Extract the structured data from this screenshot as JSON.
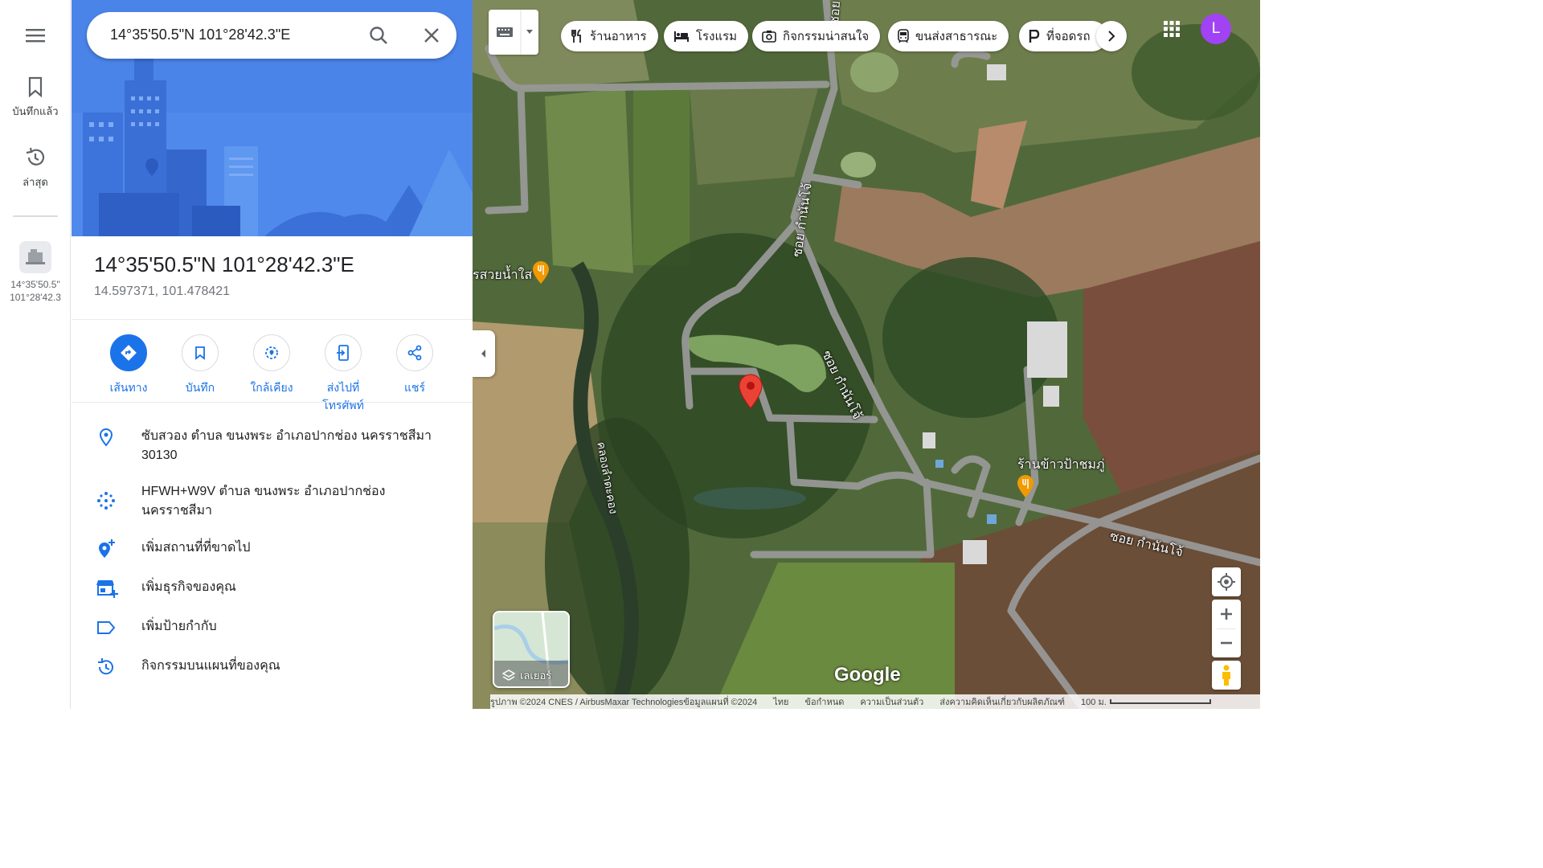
{
  "rail": {
    "saved_label": "บันทึกแล้ว",
    "recent_label": "ล่าสุด",
    "recent_item_line1": "14°35'50.5\"",
    "recent_item_line2": "101°28'42.3"
  },
  "search": {
    "query": "14°35'50.5\"N 101°28'42.3\"E"
  },
  "place": {
    "title": "14°35'50.5\"N 101°28'42.3\"E",
    "decimal": "14.597371, 101.478421"
  },
  "actions": [
    {
      "label": "เส้นทาง",
      "icon": "directions-icon"
    },
    {
      "label": "บันทึก",
      "icon": "bookmark-icon"
    },
    {
      "label": "ใกล้เคียง",
      "icon": "nearby-icon"
    },
    {
      "label": "ส่งไปที่โทรศัพท์",
      "icon": "send-to-phone-icon"
    },
    {
      "label": "แชร์",
      "icon": "share-icon"
    }
  ],
  "info": {
    "address": "ซับสวอง ตำบล ขนงพระ อำเภอปากช่อง นครราชสีมา 30130",
    "plus_code": "HFWH+W9V ตำบล ขนงพระ อำเภอปากช่อง นครราชสีมา",
    "add_missing_place": "เพิ่มสถานที่ที่ขาดไป",
    "add_business": "เพิ่มธุรกิจของคุณ",
    "add_label": "เพิ่มป้ายกำกับ",
    "map_activity": "กิจกรรมบนแผนที่ของคุณ"
  },
  "chips": [
    {
      "label": "ร้านอาหาร",
      "icon": "restaurant-icon"
    },
    {
      "label": "โรงแรม",
      "icon": "hotel-icon"
    },
    {
      "label": "กิจกรรมน่าสนใจ",
      "icon": "camera-icon"
    },
    {
      "label": "ขนส่งสาธารณะ",
      "icon": "transit-icon"
    },
    {
      "label": "ที่จอดรถ",
      "icon": "parking-icon"
    }
  ],
  "user": {
    "initial": "L"
  },
  "map_labels": {
    "road_1": "ซอย กำนันโจ้",
    "road_2": "ซอย กำนันโจ้",
    "road_3": "ซอย กำนันโจ้",
    "road_4": "ซอย กำนันโจ้",
    "canal": "คลองลำตะคอง",
    "poi_1": "รสวยน้ำใส",
    "poi_2": "ร้านข้าวป้าชมภู่"
  },
  "layers_label": "เลเยอร์",
  "brand": "Google",
  "footer": {
    "imagery": "รูปภาพ ©2024 CNES / AirbusMaxar Technologiesข้อมูลแผนที่ ©2024",
    "lang": "ไทย",
    "terms": "ข้อกำหนด",
    "privacy": "ความเป็นส่วนตัว",
    "feedback": "ส่งความคิดเห็นเกี่ยวกับผลิตภัณฑ์",
    "scale": "100 ม."
  },
  "colors": {
    "accent": "#1a73e8",
    "pin": "#ea4335",
    "avatar": "#a142f4"
  }
}
